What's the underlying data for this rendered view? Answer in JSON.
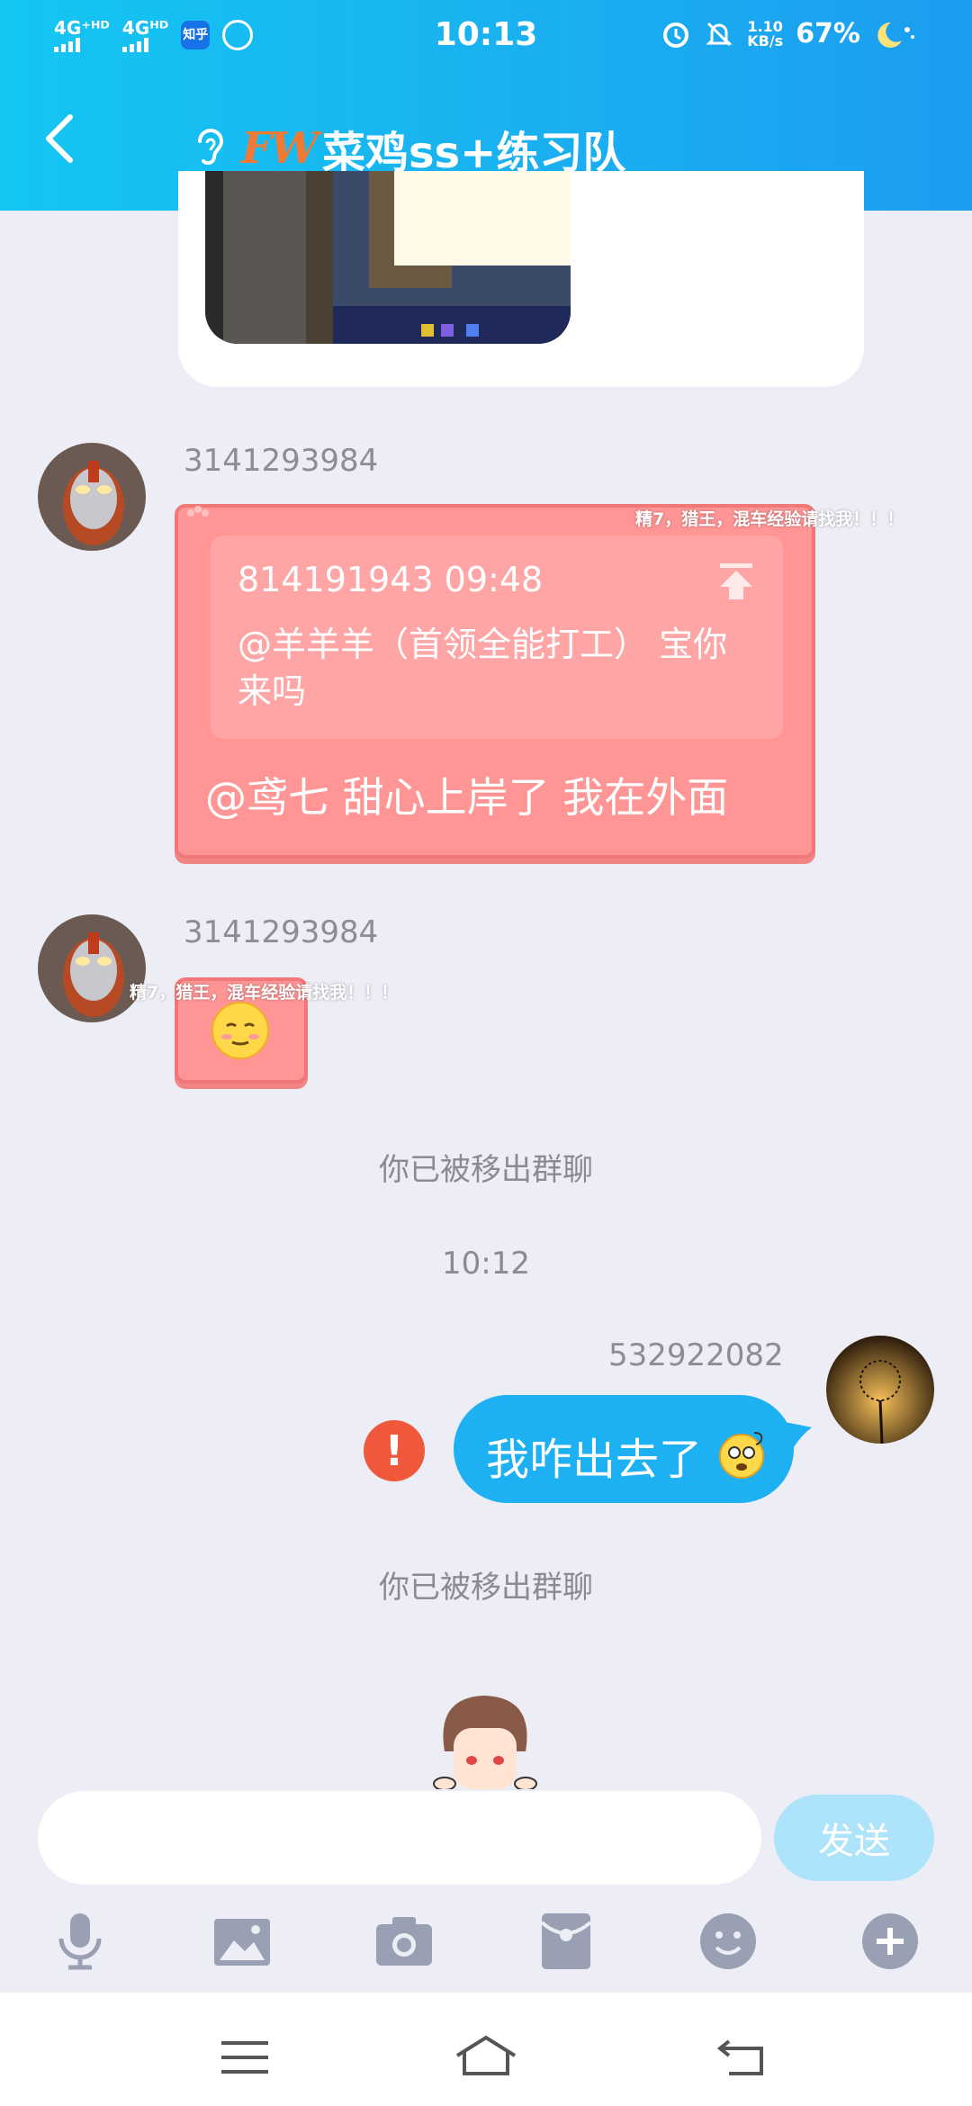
{
  "status_bar": {
    "net1": "4G⁺ᴴᴰ",
    "net2": "4Gᴴᴰ",
    "app1": "知乎",
    "time": "10:13",
    "speed_value": "1.10",
    "speed_unit": "KB/s",
    "battery": "67%"
  },
  "header": {
    "back_label": "back",
    "logo_text": "FW",
    "title": "菜鸡ss+练习队"
  },
  "messages": [
    {
      "sender": "3141293984",
      "floating_text": "精7，猎王，混车经验请找我！！！",
      "quote_meta": "814191943 09:48",
      "quote_text": "@羊羊羊（首领全能打工） 宝你来吗",
      "text": "@鸢七 甜心上岸了 我在外面"
    },
    {
      "sender": "3141293984",
      "floating_text": "精7，猎王，混车经验请找我！！！"
    }
  ],
  "system": {
    "removed_1": "你已被移出群聊",
    "timestamp": "10:12",
    "removed_2": "你已被移出群聊"
  },
  "my_message": {
    "sender": "532922082",
    "text": "我咋出去了",
    "error_symbol": "!"
  },
  "input": {
    "placeholder": "",
    "send_label": "发送"
  },
  "toolbar": {
    "icons": [
      "microphone-icon",
      "image-icon",
      "camera-icon",
      "red-packet-icon",
      "emoji-icon",
      "plus-icon"
    ]
  },
  "colors": {
    "header": "#17b8f2",
    "red_bubble": "#ff9595",
    "blue_bubble": "#1db1f4",
    "send_button": "#aee4fb",
    "background": "#ededf5"
  }
}
